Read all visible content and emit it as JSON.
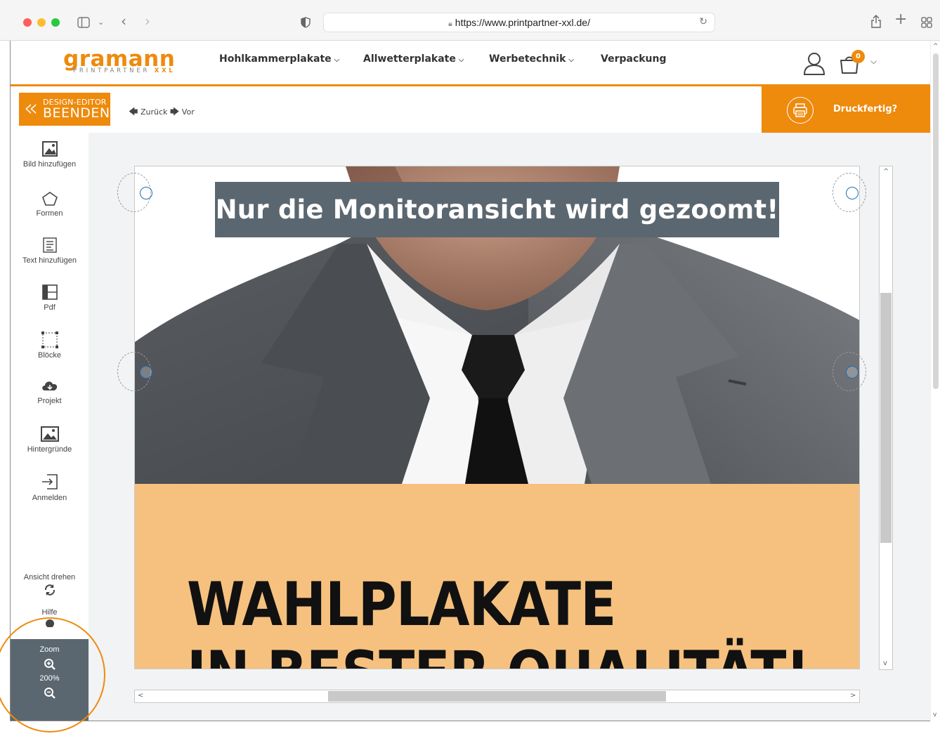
{
  "browser": {
    "url": "https://www.printpartner-xxl.de/",
    "traffic_colors": [
      "#ff5f57",
      "#febc2e",
      "#28c840"
    ]
  },
  "site": {
    "logo_main": "gramann",
    "logo_sub": "PRINTPARTNER",
    "logo_sub_accent": "XXL",
    "accent_color": "#ee8a0c",
    "nav": [
      "Hohlkammerplakate",
      "Allwetterplakate",
      "Werbetechnik",
      "Verpackung"
    ],
    "cart_count": "0"
  },
  "editor": {
    "exit_line1": "DESIGN-EDITOR",
    "exit_line2": "BEENDEN",
    "undo_label": "Zurück",
    "redo_label": "Vor",
    "print_label": "Druckfertig?"
  },
  "tools": {
    "add_image": "Bild hinzufügen",
    "shapes": "Formen",
    "add_text": "Text hinzufügen",
    "pdf": "Pdf",
    "blocks": "Blöcke",
    "project": "Projekt",
    "backgrounds": "Hintergründe",
    "login": "Anmelden",
    "rotate_view": "Ansicht drehen",
    "help": "Hilfe"
  },
  "zoom": {
    "label": "Zoom",
    "level": "200%"
  },
  "poster": {
    "banner_text": "Nur die Monitoransicht wird gezoomt!",
    "headline_line1": "WAHLPLAKATE",
    "headline_line2": "IN BESTER QUALITÄT!",
    "background_color": "#f6c17e"
  }
}
